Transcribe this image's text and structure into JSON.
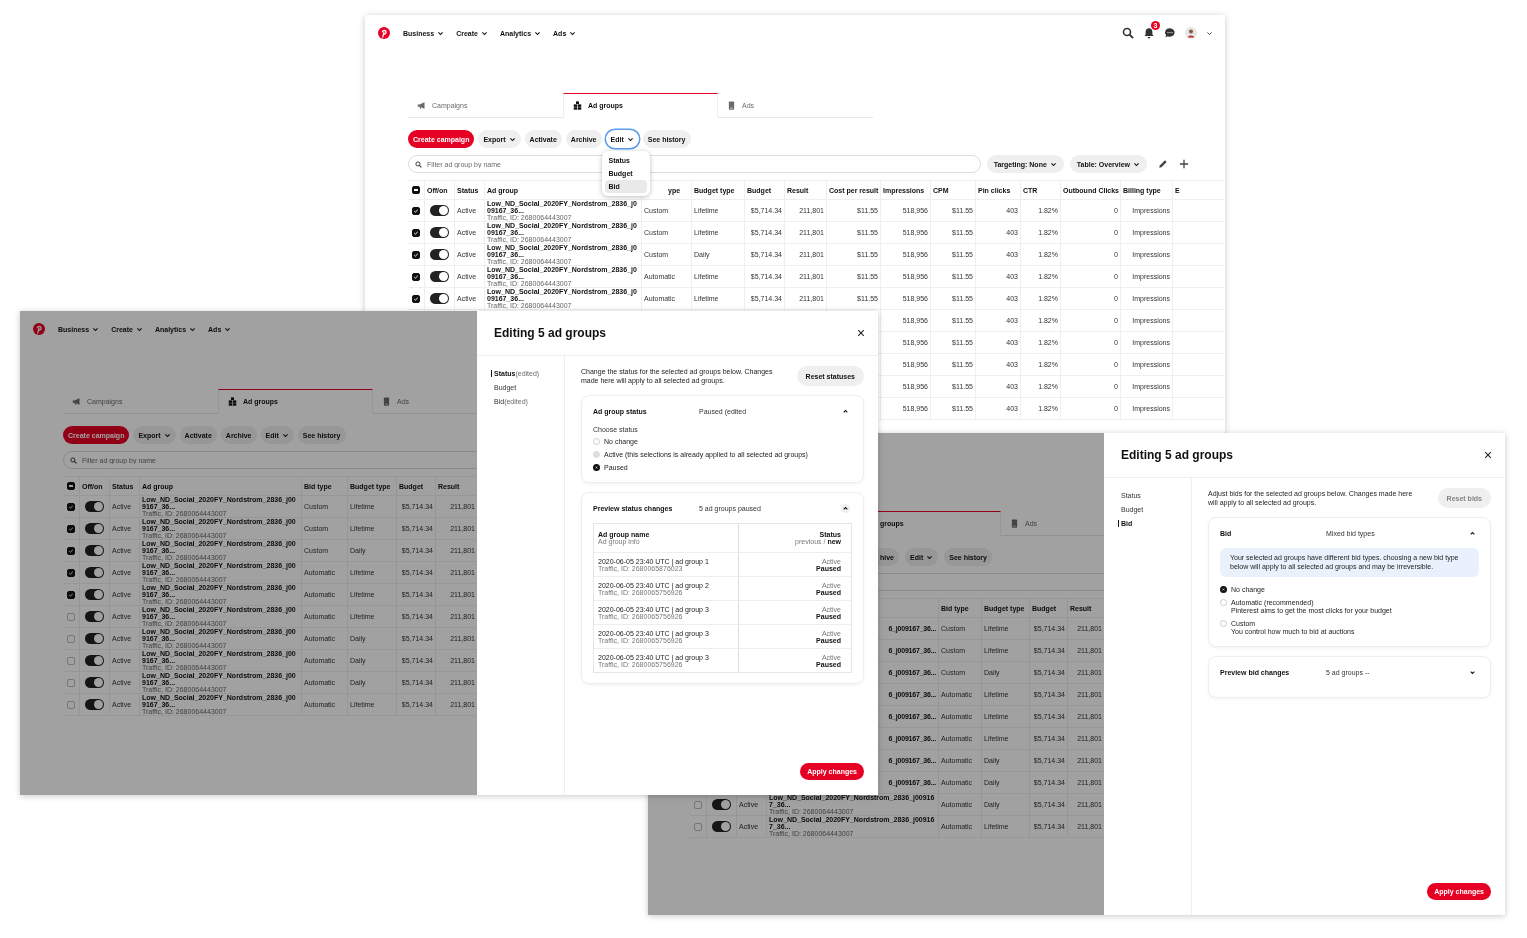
{
  "top_window": {
    "page": {
      "nav_menus": [
        "Business",
        "Create",
        "Analytics",
        "Ads"
      ],
      "notification_count": "3",
      "tabs": [
        {
          "label": "Campaigns",
          "selected": false
        },
        {
          "label": "Ad groups",
          "selected": true
        },
        {
          "label": "Ads",
          "selected": false
        }
      ],
      "actions": [
        {
          "label": "Create campaign",
          "kind": "primary",
          "focused": false
        },
        {
          "label": "Export",
          "kind": "dropdown",
          "focused": false
        },
        {
          "label": "Activate",
          "kind": "plain",
          "focused": false
        },
        {
          "label": "Archive",
          "kind": "plain",
          "focused": false
        },
        {
          "label": "Edit",
          "kind": "dropdown",
          "focused": true
        },
        {
          "label": "See history",
          "kind": "plain",
          "focused": false
        }
      ],
      "edit_menu": [
        {
          "label": "Status",
          "selected": false
        },
        {
          "label": "Budget",
          "selected": false
        },
        {
          "label": "Bid",
          "selected": true
        }
      ],
      "search": {
        "placeholder": "Filter ad group by name"
      },
      "filters": [
        "Targeting: None",
        "Table: Overview"
      ],
      "table": {
        "select_all": {
          "mixed": true
        },
        "fixed_columns": [
          {
            "label": "Off/on"
          },
          {
            "label": "Status"
          },
          {
            "label": "Ad group"
          }
        ],
        "columns": [
          {
            "label": "ype",
            "covered": true
          },
          {
            "label": "Budget type",
            "covered": false
          },
          {
            "label": "Budget",
            "covered": false
          },
          {
            "label": "Result",
            "covered": false
          },
          {
            "label": "Cost per result",
            "covered": false
          },
          {
            "label": "Impressions",
            "covered": false
          },
          {
            "label": "CPM",
            "covered": false
          },
          {
            "label": "Pin clicks",
            "covered": false
          },
          {
            "label": "CTR",
            "covered": false
          },
          {
            "label": "Outbound Clicks",
            "covered": false
          },
          {
            "label": "Billing type",
            "covered": false
          },
          {
            "label": "E",
            "covered": false
          }
        ],
        "rows": [
          {
            "checked": true,
            "on": true,
            "status": "Active",
            "name": "Low_ND_Social_2020FY_Nordstrom_2836_j009167_36...",
            "info": "Traffic, ID: 2680064443007",
            "cells": [
              "Custom",
              "Lifetime",
              "$5,714.34",
              "211,801",
              "$11.55",
              "518,956",
              "$11.55",
              "403",
              "1.82%",
              "0",
              "Impressions"
            ]
          },
          {
            "checked": true,
            "on": true,
            "status": "Active",
            "name": "Low_ND_Social_2020FY_Nordstrom_2836_j009167_36...",
            "info": "Traffic, ID: 2680064443007",
            "cells": [
              "Custom",
              "Lifetime",
              "$5,714.34",
              "211,801",
              "$11.55",
              "518,956",
              "$11.55",
              "403",
              "1.82%",
              "0",
              "Impressions"
            ]
          },
          {
            "checked": true,
            "on": true,
            "status": "Active",
            "name": "Low_ND_Social_2020FY_Nordstrom_2836_j009167_36...",
            "info": "Traffic, ID: 2680064443007",
            "cells": [
              "Custom",
              "Daily",
              "$5,714.34",
              "211,801",
              "$11.55",
              "518,956",
              "$11.55",
              "403",
              "1.82%",
              "0",
              "Impressions"
            ]
          },
          {
            "checked": true,
            "on": true,
            "status": "Active",
            "name": "Low_ND_Social_2020FY_Nordstrom_2836_j009167_36...",
            "info": "Traffic, ID: 2680064443007",
            "cells": [
              "Automatic",
              "Lifetime",
              "$5,714.34",
              "211,801",
              "$11.55",
              "518,956",
              "$11.55",
              "403",
              "1.82%",
              "0",
              "Impressions"
            ]
          },
          {
            "checked": true,
            "on": true,
            "status": "Active",
            "name": "Low_ND_Social_2020FY_Nordstrom_2836_j009167_36...",
            "info": "Traffic, ID: 2680064443007",
            "cells": [
              "Automatic",
              "Lifetime",
              "$5,714.34",
              "211,801",
              "$11.55",
              "518,956",
              "$11.55",
              "403",
              "1.82%",
              "0",
              "Impressions"
            ]
          },
          {
            "cells": [
              "",
              "",
              "",
              "",
              "",
              "518,956",
              "$11.55",
              "403",
              "1.82%",
              "0",
              "Impressions"
            ]
          },
          {
            "cells": [
              "",
              "",
              "",
              "",
              "",
              "518,956",
              "$11.55",
              "403",
              "1.82%",
              "0",
              "Impressions"
            ]
          },
          {
            "cells": [
              "",
              "",
              "",
              "",
              "",
              "518,956",
              "$11.55",
              "403",
              "1.82%",
              "0",
              "Impressions"
            ]
          },
          {
            "cells": [
              "",
              "",
              "",
              "",
              "",
              "518,956",
              "$11.55",
              "403",
              "1.82%",
              "0",
              "Impressions"
            ]
          },
          {
            "cells": [
              "",
              "",
              "",
              "",
              "",
              "518,956",
              "$11.55",
              "403",
              "1.82%",
              "0",
              "Impressions"
            ]
          }
        ]
      }
    }
  },
  "left_window": {
    "page": {
      "nav_menus": [
        "Business",
        "Create",
        "Analytics",
        "Ads"
      ],
      "tabs": [
        {
          "label": "Campaigns",
          "selected": false
        },
        {
          "label": "Ad groups",
          "selected": true
        },
        {
          "label": "Ads",
          "selected": false
        }
      ],
      "actions": [
        {
          "label": "Create campaign",
          "kind": "primary",
          "focused": false
        },
        {
          "label": "Export",
          "kind": "dropdown",
          "focused": false
        },
        {
          "label": "Activate",
          "kind": "plain",
          "focused": false
        },
        {
          "label": "Archive",
          "kind": "plain",
          "focused": false
        },
        {
          "label": "Edit",
          "kind": "dropdown",
          "focused": false
        },
        {
          "label": "See history",
          "kind": "plain",
          "focused": false
        }
      ],
      "search": {
        "placeholder": "Filter ad group by name"
      },
      "table": {
        "select_all": {
          "mixed": true
        },
        "fixed_columns": [
          {
            "label": "Off/on"
          },
          {
            "label": "Status"
          },
          {
            "label": "Ad group"
          }
        ],
        "columns": [
          {
            "label": "Bid type"
          },
          {
            "label": "Budget type"
          },
          {
            "label": "Budget"
          },
          {
            "label": "Result"
          }
        ],
        "rows": [
          {
            "checked": true,
            "on": true,
            "status": "Active",
            "name": "Low_ND_Social_2020FY_Nordstrom_2836_j009167_36...",
            "info": "Traffic, ID: 2680064443007",
            "cells": [
              "Custom",
              "Lifetime",
              "$5,714.34",
              "211,801"
            ]
          },
          {
            "checked": true,
            "on": true,
            "status": "Active",
            "name": "Low_ND_Social_2020FY_Nordstrom_2836_j009167_36...",
            "info": "Traffic, ID: 2680064443007",
            "cells": [
              "Custom",
              "Lifetime",
              "$5,714.34",
              "211,801"
            ]
          },
          {
            "checked": true,
            "on": true,
            "status": "Active",
            "name": "Low_ND_Social_2020FY_Nordstrom_2836_j009167_36...",
            "info": "Traffic, ID: 2680064443007",
            "cells": [
              "Custom",
              "Daily",
              "$5,714.34",
              "211,801"
            ]
          },
          {
            "checked": true,
            "on": true,
            "status": "Active",
            "name": "Low_ND_Social_2020FY_Nordstrom_2836_j009167_36...",
            "info": "Traffic, ID: 2680064443007",
            "cells": [
              "Automatic",
              "Lifetime",
              "$5,714.34",
              "211,801"
            ]
          },
          {
            "checked": true,
            "on": true,
            "status": "Active",
            "name": "Low_ND_Social_2020FY_Nordstrom_2836_j009167_36...",
            "info": "Traffic, ID: 2680064443007",
            "cells": [
              "Automatic",
              "Lifetime",
              "$5,714.34",
              "211,801"
            ]
          },
          {
            "checked": false,
            "on": true,
            "status": "Active",
            "name": "Low_ND_Social_2020FY_Nordstrom_2836_j009167_36...",
            "info": "Traffic, ID: 2680064443007",
            "cells": [
              "Automatic",
              "Lifetime",
              "$5,714.34",
              "211,801"
            ]
          },
          {
            "checked": false,
            "on": true,
            "status": "Active",
            "name": "Low_ND_Social_2020FY_Nordstrom_2836_j009167_36...",
            "info": "Traffic, ID: 2680064443007",
            "cells": [
              "Automatic",
              "Daily",
              "$5,714.34",
              "211,801"
            ]
          },
          {
            "checked": false,
            "on": true,
            "status": "Active",
            "name": "Low_ND_Social_2020FY_Nordstrom_2836_j009167_36...",
            "info": "Traffic, ID: 2680064443007",
            "cells": [
              "Automatic",
              "Daily",
              "$5,714.34",
              "211,801"
            ]
          },
          {
            "checked": false,
            "on": true,
            "status": "Active",
            "name": "Low_ND_Social_2020FY_Nordstrom_2836_j009167_36...",
            "info": "Traffic, ID: 2680064443007",
            "cells": [
              "Automatic",
              "Daily",
              "$5,714.34",
              "211,801"
            ]
          },
          {
            "checked": false,
            "on": true,
            "status": "Active",
            "name": "Low_ND_Social_2020FY_Nordstrom_2836_j009167_36...",
            "info": "Traffic, ID: 2680064443007",
            "cells": [
              "Automatic",
              "Lifetime",
              "$5,714.34",
              "211,801"
            ]
          }
        ]
      }
    },
    "dialog": {
      "title": "Editing 5 ad groups",
      "nav": [
        {
          "label": "Status",
          "note": "(edited)",
          "selected": true
        },
        {
          "label": "Budget",
          "selected": false
        },
        {
          "label": "Bid",
          "note": "(edited)",
          "selected": false
        }
      ],
      "description": "Change the status for the selected ad groups below. Changes made here will apply to all selected ad groups.",
      "reset_button": {
        "label": "Reset statuses",
        "disabled": false
      },
      "sections": [
        {
          "kind": "status",
          "title": "Ad group status",
          "summary": "Paused (edited",
          "expanded": true,
          "prompt": "Choose status",
          "options": [
            {
              "label": "No change",
              "selected": false,
              "disabled": false
            },
            {
              "label": "Active (this selections is already applied to all selected ad groups)",
              "selected": false,
              "disabled": true
            },
            {
              "label": "Paused",
              "selected": true,
              "disabled": false
            }
          ]
        },
        {
          "kind": "preview",
          "title": "Preview status changes",
          "summary": "5 ad groups paused",
          "expanded": true,
          "table": {
            "name_heading": "Ad group name",
            "info_heading": "Ad group info",
            "status_heading": "Status",
            "status_subheading": "previous / **new**",
            "rows": [
              {
                "name": "2020-06-05 23:40 UTC | ad group 1",
                "info": "Traffic, ID: 2680065876023",
                "previous": "Active",
                "new": "Paused"
              },
              {
                "name": "2020-06-05 23:40 UTC | ad group 2",
                "info": "Traffic, ID: 2680065756926",
                "previous": "Active",
                "new": "Paused"
              },
              {
                "name": "2020-06-05 23:40 UTC | ad group 3",
                "info": "Traffic, ID: 2680065756926",
                "previous": "Active",
                "new": "Paused"
              },
              {
                "name": "2020-06-05 23:40 UTC | ad group 3",
                "info": "Traffic, ID: 2680065756926",
                "previous": "Active",
                "new": "Paused"
              },
              {
                "name": "2020-06-05 23:40 UTC | ad group 3",
                "info": "Traffic, ID: 2680065756926",
                "previous": "Active",
                "new": "Paused"
              }
            ]
          }
        }
      ],
      "apply_button": "Apply changes"
    }
  },
  "bottom_window": {
    "page": {
      "tabs": [
        {
          "label": "groups",
          "selected": true
        },
        {
          "label": "Ads",
          "selected": false
        }
      ],
      "actions": [
        {
          "label": "hive",
          "kind": "plain",
          "focused": false
        },
        {
          "label": "Edit",
          "kind": "dropdown",
          "focused": false
        },
        {
          "label": "See history",
          "kind": "plain",
          "focused": false
        }
      ],
      "table": {
        "columns": [
          {
            "label": "Bid type"
          },
          {
            "label": "Budget type"
          },
          {
            "label": "Budget"
          },
          {
            "label": "Result"
          }
        ],
        "rows": [
          {
            "kind": "partial",
            "name": "6_j009167_36...",
            "cells": [
              "Custom",
              "Lifetime",
              "$5,714.34",
              "211,801"
            ]
          },
          {
            "kind": "partial",
            "name": "6_j009167_36...",
            "cells": [
              "Custom",
              "Lifetime",
              "$5,714.34",
              "211,801"
            ]
          },
          {
            "kind": "partial",
            "name": "6_j009167_36...",
            "cells": [
              "Custom",
              "Daily",
              "$5,714.34",
              "211,801"
            ]
          },
          {
            "kind": "partial",
            "name": "6_j009167_36...",
            "cells": [
              "Automatic",
              "Lifetime",
              "$5,714.34",
              "211,801"
            ]
          },
          {
            "kind": "partial",
            "name": "6_j009167_36...",
            "cells": [
              "Automatic",
              "Lifetime",
              "$5,714.34",
              "211,801"
            ]
          },
          {
            "kind": "partial",
            "name": "6_j009167_36...",
            "cells": [
              "Automatic",
              "Lifetime",
              "$5,714.34",
              "211,801"
            ]
          },
          {
            "kind": "partial",
            "name": "6_j009167_36...",
            "cells": [
              "Automatic",
              "Daily",
              "$5,714.34",
              "211,801"
            ]
          },
          {
            "kind": "partial",
            "name": "6_j009167_36...",
            "cells": [
              "Automatic",
              "Daily",
              "$5,714.34",
              "211,801"
            ]
          },
          {
            "kind": "full",
            "checked": false,
            "on": true,
            "status": "Active",
            "name": "Low_ND_Social_2020FY_Nordstrom_2836_j009167_36...",
            "info": "Traffic, ID: 2680064443007",
            "cells": [
              "Automatic",
              "Daily",
              "$5,714.34",
              "211,801"
            ]
          },
          {
            "kind": "full",
            "checked": false,
            "on": true,
            "status": "Active",
            "name": "Low_ND_Social_2020FY_Nordstrom_2836_j009167_36...",
            "info": "Traffic, ID: 2680064443007",
            "cells": [
              "Automatic",
              "Lifetime",
              "$5,714.34",
              "211,801"
            ]
          }
        ]
      }
    },
    "dialog": {
      "title": "Editing 5 ad groups",
      "nav": [
        {
          "label": "Status",
          "selected": false
        },
        {
          "label": "Budget",
          "selected": false
        },
        {
          "label": "Bid",
          "selected": true
        }
      ],
      "description": "Adjust bids for the selected ad groups below. Changes made here will apply to all selected ad groups.",
      "reset_button": {
        "label": "Reset bids",
        "disabled": true
      },
      "sections": [
        {
          "kind": "bid",
          "title": "Bid",
          "summary": "Mixed bid types",
          "expanded": true,
          "notice": "Your selected ad groups have different bid types. choosing a new bid type below will apply to all selected ad groups and may be irreversible.",
          "options": [
            {
              "label": "No change",
              "selected": true
            },
            {
              "label": "Automatic (recommended)",
              "detail": "Pinterest aims to get the most clicks for your budget",
              "selected": false
            },
            {
              "label": "Custom",
              "detail": "You control how much to bid at auctions",
              "selected": false
            }
          ]
        },
        {
          "kind": "preview",
          "title": "Preview bid changes",
          "summary": "5 ad groups --",
          "expanded": false
        }
      ],
      "apply_button": "Apply changes"
    }
  }
}
